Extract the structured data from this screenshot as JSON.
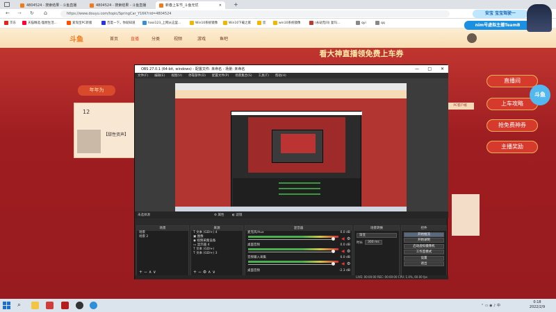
{
  "browser": {
    "tabs": [
      {
        "label": "4804524 - 搜索结果 - 斗鱼直播"
      },
      {
        "label": "4804524 - 搜索结果 - 斗鱼直播"
      },
      {
        "label": "新春上车节_斗鱼无忧"
      }
    ],
    "new_tab": "+",
    "url": "https://www.douyu.com/topic/SpringCar_Y16K?rid=4804524",
    "bookmarks": [
      "京东",
      "天猫精选-理想生活...",
      "爱淘宝PC新版",
      "百度一下，你就知道",
      "haoi123_上网从这里...",
      "Win10系统镜像",
      "Win10下载之家",
      "您",
      "win10系统镜像",
      "(永劫无间) 复玛...",
      "qyi",
      "qq"
    ],
    "window_controls": [
      "—",
      "□",
      "✕"
    ]
  },
  "site": {
    "logo": "斗鱼",
    "nav": [
      "首页",
      "直播",
      "分类",
      "视频",
      "游戏",
      "鱼吧"
    ],
    "banner": "看大神直播领免费上车券",
    "left_label": "年年为",
    "counter": "12",
    "anchor_title": "【甜性资声】",
    "sidebar": [
      "直播间",
      "上车攻略",
      "抢免费神券",
      "主播奖励"
    ],
    "promo_text": "PC客户端",
    "corner_label": "斗鱼"
  },
  "obs": {
    "title": "OBS 27.0.1 (64-bit, windows) - 配置文件: 未命名 - 场景: 未命名",
    "menu": [
      "文件(F)",
      "编辑(E)",
      "视图(V)",
      "停靠部件(D)",
      "配置文件(P)",
      "场景集合(S)",
      "工具(T)",
      "帮助(H)"
    ],
    "source_bar": {
      "label": "未选择源",
      "properties": "属性",
      "filters": "滤镜"
    },
    "panels": {
      "scenes": {
        "title": "场景",
        "items": [
          "场景",
          "场景 2"
        ]
      },
      "sources": {
        "title": "来源",
        "items": [
          "文本 (GDI+) 4",
          "图像",
          "视频采集设备",
          "显示器 4",
          "文本 (GDI+)",
          "文本 (GDI+) 3"
        ]
      },
      "mixer": {
        "title": "混音器",
        "tracks": [
          {
            "name": "麦克风/Aux",
            "db": "0.0 dB"
          },
          {
            "name": "桌面音频",
            "db": "0.0 dB"
          },
          {
            "name": "音频输入采集",
            "db": "0.0 dB"
          }
        ],
        "bottom_label": "桌面音频",
        "bottom_db": "-2.3 dB"
      },
      "transitions": {
        "title": "场景转换",
        "type": "渐变",
        "duration_label": "时长",
        "duration": "300 ms"
      },
      "controls": {
        "title": "控件",
        "buttons": [
          "开始推流",
          "开始录制",
          "启动虚拟摄像机",
          "工作室模式",
          "设置",
          "退出"
        ]
      }
    },
    "status": "LIVE: 00:00:00   REC: 00:00:00   CPU: 1.0%, 60.00 fps",
    "window_controls": [
      "—",
      "□",
      "✕"
    ]
  },
  "overlay": {
    "line1": "安宝 宝宝驾驶一",
    "line2": "nim号虚拟主播TeamB"
  },
  "taskbar": {
    "time": "0:18",
    "date": "2022/2/9"
  }
}
